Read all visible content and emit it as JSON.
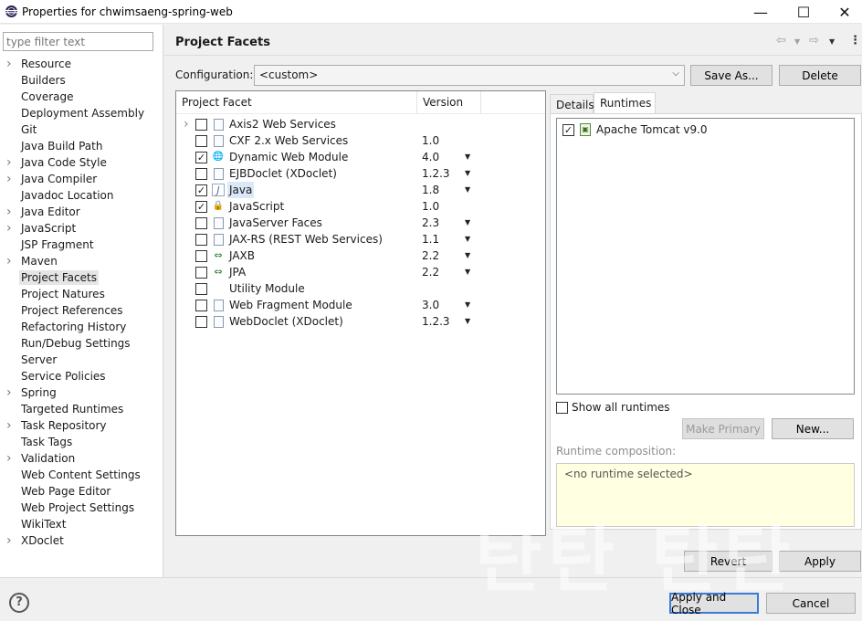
{
  "window": {
    "title": "Properties for chwimsaeng-spring-web",
    "minimize": "—",
    "maximize": "☐",
    "close": "✕"
  },
  "filter": {
    "placeholder": "type filter text"
  },
  "nav": {
    "items": [
      {
        "label": "Resource",
        "expandable": true
      },
      {
        "label": "Builders",
        "expandable": false
      },
      {
        "label": "Coverage",
        "expandable": false
      },
      {
        "label": "Deployment Assembly",
        "expandable": false
      },
      {
        "label": "Git",
        "expandable": false
      },
      {
        "label": "Java Build Path",
        "expandable": false
      },
      {
        "label": "Java Code Style",
        "expandable": true
      },
      {
        "label": "Java Compiler",
        "expandable": true
      },
      {
        "label": "Javadoc Location",
        "expandable": false
      },
      {
        "label": "Java Editor",
        "expandable": true
      },
      {
        "label": "JavaScript",
        "expandable": true
      },
      {
        "label": "JSP Fragment",
        "expandable": false
      },
      {
        "label": "Maven",
        "expandable": true
      },
      {
        "label": "Project Facets",
        "expandable": false,
        "selected": true
      },
      {
        "label": "Project Natures",
        "expandable": false
      },
      {
        "label": "Project References",
        "expandable": false
      },
      {
        "label": "Refactoring History",
        "expandable": false
      },
      {
        "label": "Run/Debug Settings",
        "expandable": false
      },
      {
        "label": "Server",
        "expandable": false
      },
      {
        "label": "Service Policies",
        "expandable": false
      },
      {
        "label": "Spring",
        "expandable": true
      },
      {
        "label": "Targeted Runtimes",
        "expandable": false
      },
      {
        "label": "Task Repository",
        "expandable": true
      },
      {
        "label": "Task Tags",
        "expandable": false
      },
      {
        "label": "Validation",
        "expandable": true
      },
      {
        "label": "Web Content Settings",
        "expandable": false
      },
      {
        "label": "Web Page Editor",
        "expandable": false
      },
      {
        "label": "Web Project Settings",
        "expandable": false
      },
      {
        "label": "WikiText",
        "expandable": false
      },
      {
        "label": "XDoclet",
        "expandable": true
      }
    ]
  },
  "page": {
    "title": "Project Facets",
    "configuration_label": "Configuration:",
    "configuration_value": "<custom>",
    "save_as": "Save As...",
    "delete": "Delete"
  },
  "facets": {
    "col_facet": "Project Facet",
    "col_version": "Version",
    "rows": [
      {
        "name": "Axis2 Web Services",
        "version": "",
        "checked": false,
        "expandable": true,
        "icon": "doc",
        "dropdown": false
      },
      {
        "name": "CXF 2.x Web Services",
        "version": "1.0",
        "checked": false,
        "icon": "doc",
        "dropdown": false
      },
      {
        "name": "Dynamic Web Module",
        "version": "4.0",
        "checked": true,
        "icon": "globe",
        "dropdown": true
      },
      {
        "name": "EJBDoclet (XDoclet)",
        "version": "1.2.3",
        "checked": false,
        "icon": "doc",
        "dropdown": true
      },
      {
        "name": "Java",
        "version": "1.8",
        "checked": true,
        "icon": "java",
        "dropdown": true,
        "highlight": true
      },
      {
        "name": "JavaScript",
        "version": "1.0",
        "checked": true,
        "icon": "lock",
        "dropdown": false
      },
      {
        "name": "JavaServer Faces",
        "version": "2.3",
        "checked": false,
        "icon": "doc",
        "dropdown": true
      },
      {
        "name": "JAX-RS (REST Web Services)",
        "version": "1.1",
        "checked": false,
        "icon": "doc",
        "dropdown": true
      },
      {
        "name": "JAXB",
        "version": "2.2",
        "checked": false,
        "icon": "arrows",
        "dropdown": true
      },
      {
        "name": "JPA",
        "version": "2.2",
        "checked": false,
        "icon": "arrows",
        "dropdown": true
      },
      {
        "name": "Utility Module",
        "version": "",
        "checked": false,
        "icon": "none",
        "dropdown": false
      },
      {
        "name": "Web Fragment Module",
        "version": "3.0",
        "checked": false,
        "icon": "doc",
        "dropdown": true
      },
      {
        "name": "WebDoclet (XDoclet)",
        "version": "1.2.3",
        "checked": false,
        "icon": "doc",
        "dropdown": true
      }
    ]
  },
  "tabs": {
    "details": "Details",
    "runtimes": "Runtimes"
  },
  "runtimes": {
    "items": [
      {
        "name": "Apache Tomcat v9.0",
        "checked": true
      }
    ],
    "show_all": "Show all runtimes",
    "make_primary": "Make Primary",
    "new": "New...",
    "composition_label": "Runtime composition:",
    "composition_value": "<no runtime selected>"
  },
  "actions": {
    "revert": "Revert",
    "apply": "Apply",
    "apply_close": "Apply and Close",
    "cancel": "Cancel",
    "help": "?"
  },
  "watermark": "탄탄 탄탄"
}
